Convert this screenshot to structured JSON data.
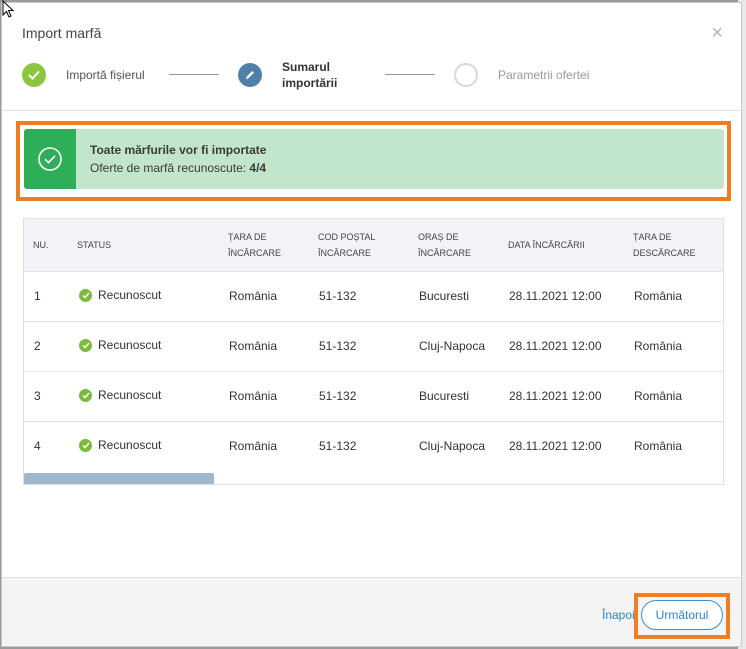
{
  "modal": {
    "title": "Import marfă",
    "close_symbol": "×"
  },
  "steps": [
    {
      "label": "Importă fișierul",
      "state": "done"
    },
    {
      "label_line1": "Sumarul",
      "label_line2": "importării",
      "state": "active"
    },
    {
      "label": "Parametrii ofertei",
      "state": "pending"
    }
  ],
  "banner": {
    "title": "Toate mărfurile vor fi importate",
    "subtitle": "Oferte de marfă recunoscute:",
    "count": "4/4",
    "color": "#2fae5a"
  },
  "table": {
    "headers": [
      {
        "line1": "NU.",
        "line2": ""
      },
      {
        "line1": "STATUS",
        "line2": ""
      },
      {
        "line1": "ȚARA DE",
        "line2": "ÎNCĂRCARE"
      },
      {
        "line1": "COD POȘTAL",
        "line2": "ÎNCĂRCARE"
      },
      {
        "line1": "ORAȘ DE",
        "line2": "ÎNCĂRCARE"
      },
      {
        "line1": "DATA ÎNCĂRCĂRII",
        "line2": ""
      },
      {
        "line1": "ȚARA DE",
        "line2": "DESCĂRCARE"
      }
    ],
    "rows": [
      {
        "nr": "1",
        "status": "Recunoscut",
        "country": "România",
        "postal": "51-132",
        "city": "Bucuresti",
        "date": "28.11.2021 12:00",
        "unload_country": "România"
      },
      {
        "nr": "2",
        "status": "Recunoscut",
        "country": "România",
        "postal": "51-132",
        "city": "Cluj-Napoca",
        "date": "28.11.2021 12:00",
        "unload_country": "România"
      },
      {
        "nr": "3",
        "status": "Recunoscut",
        "country": "România",
        "postal": "51-132",
        "city": "Bucuresti",
        "date": "28.11.2021 12:00",
        "unload_country": "România"
      },
      {
        "nr": "4",
        "status": "Recunoscut",
        "country": "România",
        "postal": "51-132",
        "city": "Cluj-Napoca",
        "date": "28.11.2021 12:00",
        "unload_country": "România"
      }
    ]
  },
  "footer": {
    "back_label": "Înapoi",
    "next_label": "Următorul"
  },
  "colors": {
    "accent": "#2f86c9",
    "highlight": "#ef7d22",
    "success": "#7cba3d"
  }
}
